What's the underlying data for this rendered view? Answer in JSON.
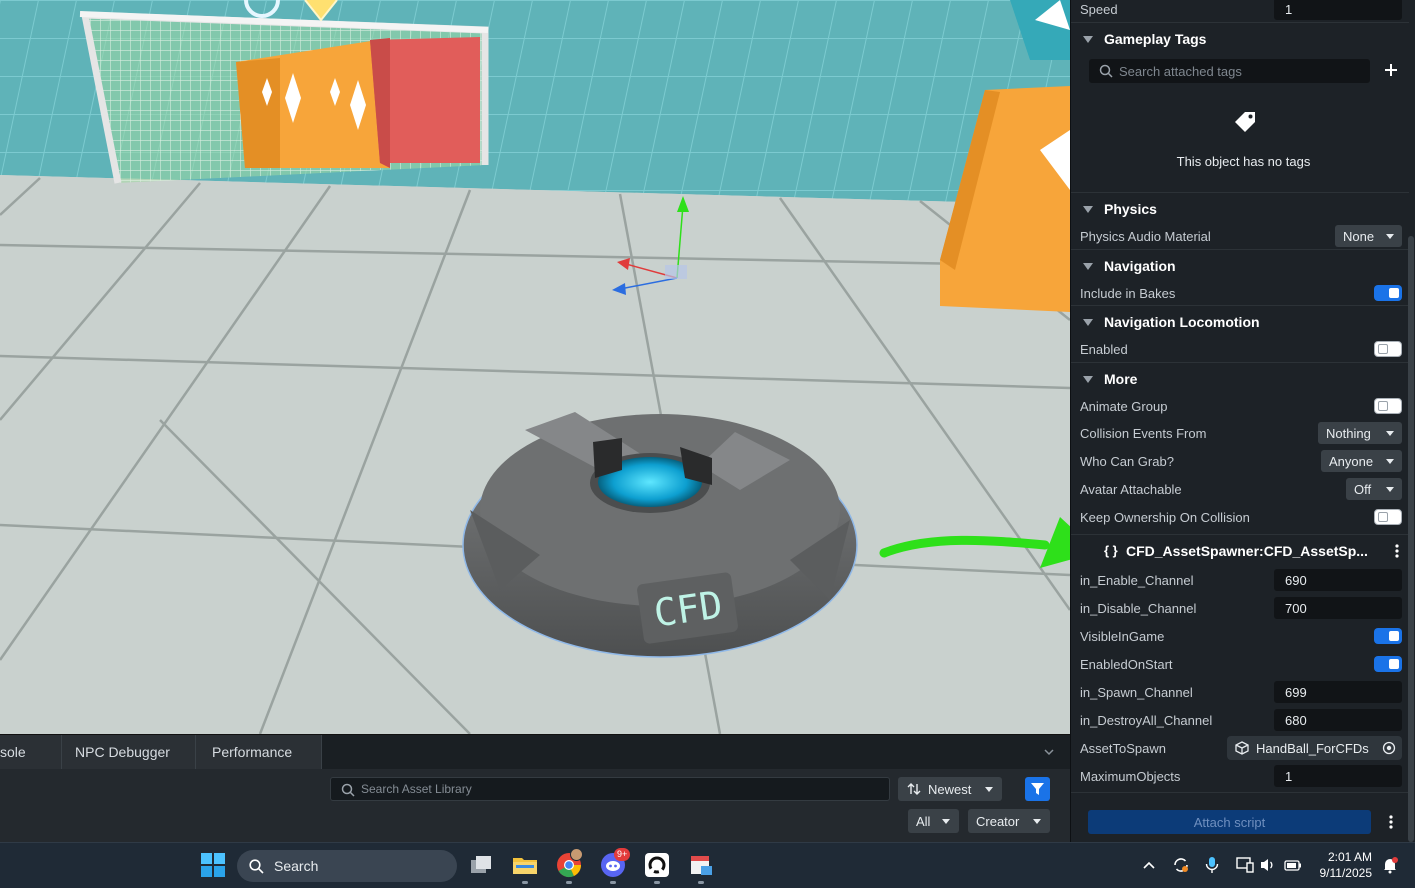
{
  "right_panel": {
    "speed": {
      "label": "Speed",
      "value": "1"
    },
    "gameplay_tags": {
      "title": "Gameplay Tags",
      "search_placeholder": "Search attached tags",
      "empty_text": "This object has no tags"
    },
    "physics": {
      "title": "Physics",
      "audio_material_label": "Physics Audio Material",
      "audio_material_value": "None"
    },
    "navigation": {
      "title": "Navigation",
      "include_in_bakes_label": "Include in Bakes",
      "include_in_bakes": true
    },
    "navigation_locomotion": {
      "title": "Navigation Locomotion",
      "enabled_label": "Enabled",
      "enabled": false
    },
    "more": {
      "title": "More",
      "animate_group_label": "Animate Group",
      "animate_group": false,
      "collision_events_label": "Collision Events From",
      "collision_events_value": "Nothing",
      "who_can_grab_label": "Who Can Grab?",
      "who_can_grab_value": "Anyone",
      "avatar_attachable_label": "Avatar Attachable",
      "avatar_attachable_value": "Off",
      "keep_ownership_label": "Keep Ownership On Collision",
      "keep_ownership": false
    },
    "script": {
      "icon_text": "{ }",
      "title": "CFD_AssetSpawner:CFD_AssetSp...",
      "in_enable_channel_label": "in_Enable_Channel",
      "in_enable_channel": "690",
      "in_disable_channel_label": "in_Disable_Channel",
      "in_disable_channel": "700",
      "visible_in_game_label": "VisibleInGame",
      "visible_in_game": true,
      "enabled_on_start_label": "EnabledOnStart",
      "enabled_on_start": true,
      "in_spawn_channel_label": "in_Spawn_Channel",
      "in_spawn_channel": "699",
      "in_destroyall_channel_label": "in_DestroyAll_Channel",
      "in_destroyall_channel": "680",
      "asset_to_spawn_label": "AssetToSpawn",
      "asset_to_spawn": "HandBall_ForCFDs",
      "maximum_objects_label": "MaximumObjects",
      "maximum_objects": "1"
    },
    "attach_script_label": "Attach script"
  },
  "bottom_panel": {
    "tabs": [
      "sole",
      "NPC Debugger",
      "Performance"
    ],
    "search_placeholder": "Search Asset Library",
    "sort_label": "Newest",
    "filter_all": "All",
    "filter_creator": "Creator"
  },
  "viewport": {
    "pad_label": "CFD"
  },
  "taskbar": {
    "search_label": "Search",
    "discord_badge": "9+",
    "time": "2:01 AM",
    "date": "9/11/2025"
  },
  "colors": {
    "accent_blue": "#1a73e8",
    "annotation_green": "#2ee01a",
    "panel_bg": "#1d2227"
  }
}
